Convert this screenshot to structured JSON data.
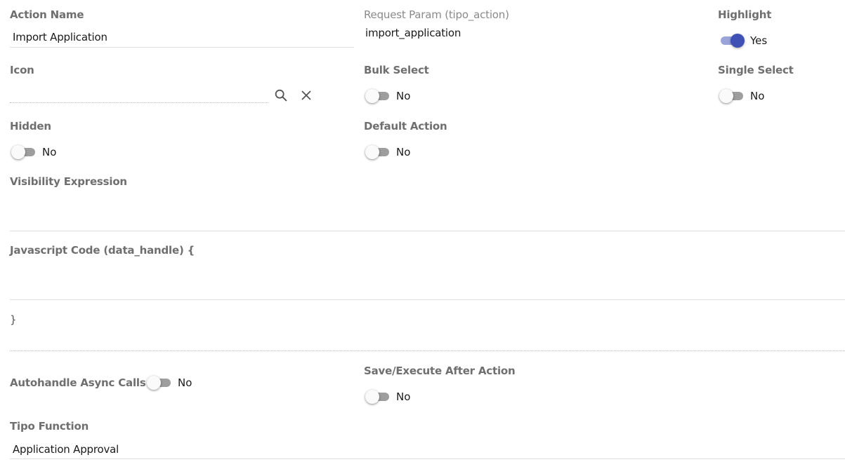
{
  "action_name": {
    "label": "Action Name",
    "value": "Import Application"
  },
  "request_param": {
    "label": "Request Param (tipo_action)",
    "value": "import_application"
  },
  "highlight": {
    "label": "Highlight",
    "state": "Yes",
    "on": true
  },
  "icon": {
    "label": "Icon",
    "value": ""
  },
  "bulk_select": {
    "label": "Bulk Select",
    "state": "No",
    "on": false
  },
  "single_select": {
    "label": "Single Select",
    "state": "No",
    "on": false
  },
  "hidden": {
    "label": "Hidden",
    "state": "No",
    "on": false
  },
  "default_action": {
    "label": "Default Action",
    "state": "No",
    "on": false
  },
  "visibility_expression": {
    "label": "Visibility Expression",
    "value": ""
  },
  "javascript_code": {
    "label": "Javascript Code (data_handle) {",
    "closing": "}",
    "value": ""
  },
  "autohandle_async": {
    "label": "Autohandle Async Calls",
    "state": "No",
    "on": false
  },
  "save_execute_after": {
    "label": "Save/Execute After Action",
    "state": "No",
    "on": false
  },
  "tipo_function": {
    "label": "Tipo Function",
    "value": "Application Approval"
  },
  "colors": {
    "accent": "#3f51b5",
    "accent_track": "#9aa4d9",
    "label": "#6f6f6f"
  },
  "icons": {
    "search": "search-icon",
    "clear": "close-icon"
  }
}
